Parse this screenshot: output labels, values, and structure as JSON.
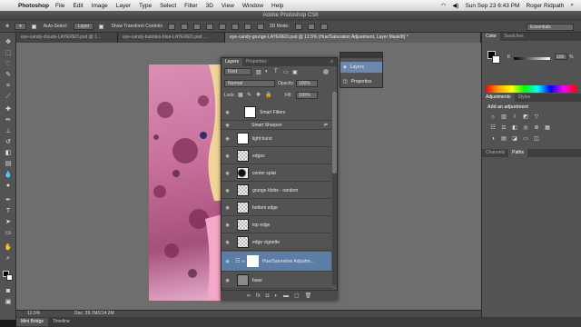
{
  "menubar": {
    "app_name": "Photoshop",
    "items": [
      "File",
      "Edit",
      "Image",
      "Layer",
      "Type",
      "Select",
      "Filter",
      "3D",
      "View",
      "Window",
      "Help"
    ],
    "clock": "Sun Sep 23  6:43 PM",
    "user": "Roger Ridpath"
  },
  "window": {
    "title": "Adobe Photoshop CS6"
  },
  "options": {
    "auto_select_label": "Auto-Select:",
    "auto_select_value": "Layer",
    "transform_controls_label": "Show Transform Controls",
    "mode_3d_label": "3D Mode:",
    "workspace": "Essentials"
  },
  "doc_tabs": [
    {
      "label": "eye-candy-clouds-LAYERED.psd @ 1..."
    },
    {
      "label": "eye-candy-bubbles-blue-LAYERED.psd ..."
    },
    {
      "label": "eye-candy-grunge-LAYERED.psd @ 12.5% (Hue/Saturation Adjustment, Layer Mask/8) *"
    }
  ],
  "status": {
    "zoom": "12.5%",
    "doc": "Doc: 39.7M/214.2M"
  },
  "bottom_tabs": [
    "Mini Bridge",
    "Timeline"
  ],
  "layers_panel": {
    "tabs": [
      "Layers",
      "Properties"
    ],
    "filter_label": "Kind",
    "blend_mode": "Normal",
    "opacity_label": "Opacity:",
    "opacity_value": "100%",
    "lock_label": "Lock:",
    "fill_label": "Fill:",
    "fill_value": "100%",
    "smart_filters_label": "Smart Filters",
    "smart_sharpen_label": "Smart Sharpen",
    "layers": [
      {
        "name": "light burst"
      },
      {
        "name": "edges"
      },
      {
        "name": "center splat"
      },
      {
        "name": "grunge blobs - random"
      },
      {
        "name": "bottom edge"
      },
      {
        "name": "top edge"
      },
      {
        "name": "edge vignette"
      },
      {
        "name": "Hue/Saturation Adjustm..."
      },
      {
        "name": "base"
      }
    ]
  },
  "float_panel": {
    "items": [
      "Layers",
      "Properties"
    ]
  },
  "right_panels": {
    "color_tabs": [
      "Color",
      "Swatches"
    ],
    "color_k_label": "K",
    "color_k_value": "100",
    "color_k_unit": "%",
    "adjustments_tabs": [
      "Adjustments",
      "Styles"
    ],
    "adjustments_hint": "Add an adjustment",
    "channels_tabs": [
      "Channels",
      "Paths"
    ]
  }
}
